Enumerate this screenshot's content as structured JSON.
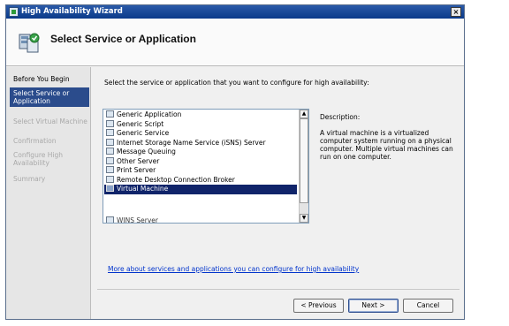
{
  "window": {
    "title": "High Availability Wizard"
  },
  "header": {
    "title": "Select Service or Application"
  },
  "sidebar": {
    "steps": [
      {
        "label": "Before You Begin",
        "state": "done"
      },
      {
        "label": "Select Service or Application",
        "state": "active"
      },
      {
        "label": "Select Virtual Machine",
        "state": "pending"
      },
      {
        "label": "Confirmation",
        "state": "pending"
      },
      {
        "label": "Configure High Availability",
        "state": "pending"
      },
      {
        "label": "Summary",
        "state": "pending"
      }
    ]
  },
  "main": {
    "instruction": "Select the service or application that you want to configure for high availability:",
    "list": {
      "items": [
        {
          "label": "Generic Application",
          "icon": "generic-application-icon"
        },
        {
          "label": "Generic Script",
          "icon": "generic-script-icon"
        },
        {
          "label": "Generic Service",
          "icon": "generic-service-icon"
        },
        {
          "label": "Internet Storage Name Service (iSNS) Server",
          "icon": "isns-server-icon"
        },
        {
          "label": "Message Queuing",
          "icon": "message-queuing-icon"
        },
        {
          "label": "Other Server",
          "icon": "other-server-icon"
        },
        {
          "label": "Print Server",
          "icon": "print-server-icon"
        },
        {
          "label": "Remote Desktop Connection Broker",
          "icon": "remote-desktop-icon"
        },
        {
          "label": "Virtual Machine",
          "icon": "virtual-machine-icon",
          "selected": true
        },
        {
          "label": "WINS Server",
          "icon": "wins-server-icon",
          "partial": true
        }
      ]
    },
    "description_label": "Description:",
    "description_text": "A virtual machine is a virtualized computer system running on a physical computer. Multiple virtual machines can run on one computer.",
    "more_link": "More about services and applications you can configure for high availability"
  },
  "footer": {
    "previous_label": "< Previous",
    "next_label": "Next >",
    "cancel_label": "Cancel"
  },
  "colors": {
    "title_bar": "#0b3a8a",
    "selection": "#10246a",
    "active_step": "#2b4c8c",
    "link": "#0033cc"
  }
}
